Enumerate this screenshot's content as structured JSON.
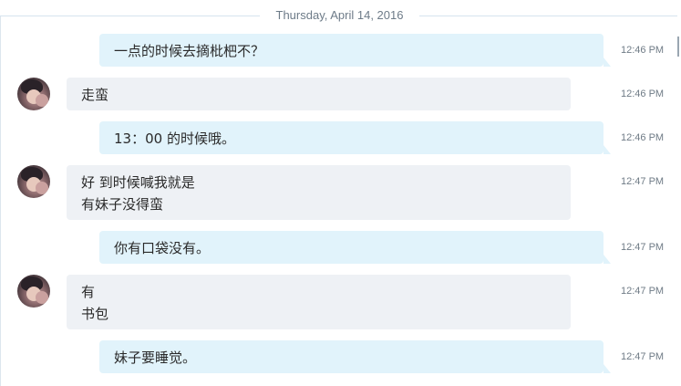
{
  "date_separator": "Thursday, April 14, 2016",
  "messages": [
    {
      "direction": "outgoing",
      "lines": [
        "一点的时候去摘枇杷不？"
      ],
      "time": "12:46 PM"
    },
    {
      "direction": "incoming",
      "lines": [
        "走蛮"
      ],
      "time": "12:46 PM"
    },
    {
      "direction": "outgoing",
      "lines": [
        "13：00 的时候哦。"
      ],
      "time": "12:46 PM"
    },
    {
      "direction": "incoming",
      "lines": [
        "好 到时候喊我就是",
        "有妹子没得蛮"
      ],
      "time": "12:47 PM"
    },
    {
      "direction": "outgoing",
      "lines": [
        "你有口袋没有。"
      ],
      "time": "12:47 PM"
    },
    {
      "direction": "incoming",
      "lines": [
        "有",
        "书包"
      ],
      "time": "12:47 PM"
    },
    {
      "direction": "outgoing",
      "lines": [
        "妹子要睡觉。"
      ],
      "time": "12:47 PM"
    }
  ],
  "colors": {
    "outgoing_bubble": "#e1f3fb",
    "incoming_bubble": "#eef1f5",
    "timestamp": "#6f7b86",
    "separator_line": "#d6e3ee"
  },
  "icons": {
    "contact_avatar": "avatar-photo"
  }
}
